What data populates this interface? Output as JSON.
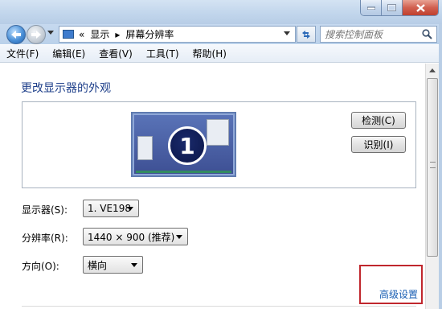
{
  "window": {
    "controls": [
      "minimize",
      "maximize",
      "close"
    ]
  },
  "nav": {
    "back_icon": "back-arrow-icon",
    "forward_icon": "forward-arrow-icon",
    "breadcrumb_prefix": "«",
    "breadcrumb": [
      "显示",
      "屏幕分辨率"
    ],
    "breadcrumb_separator": "▸",
    "search_placeholder": "搜索控制面板"
  },
  "menu": [
    "文件(F)",
    "编辑(E)",
    "查看(V)",
    "工具(T)",
    "帮助(H)"
  ],
  "main": {
    "heading": "更改显示器的外观",
    "monitor_number": "1",
    "detect_button": "检测(C)",
    "identify_button": "识别(I)",
    "display_label": "显示器(S):",
    "display_value": "1. VE198",
    "resolution_label": "分辨率(R):",
    "resolution_value": "1440 × 900 (推荐)",
    "orientation_label": "方向(O):",
    "orientation_value": "横向",
    "advanced_link": "高级设置"
  },
  "colors": {
    "heading": "#1e3f8a",
    "link": "#1a5fb4",
    "highlight_box": "#c0272d",
    "monitor": "#3d4f93"
  }
}
